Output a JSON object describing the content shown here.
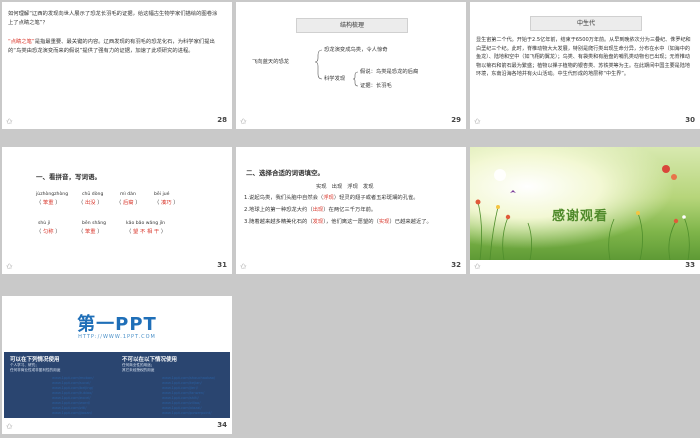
{
  "footer_icon": "slide-star-icon",
  "slides": [
    {
      "number": "28",
      "question": "如何理解“辽西的发现向世人展示了恐龙长羽毛的证据，给这幅古生物学家们描绘的图卷涂上了点睛之笔”？",
      "answer_quote": "“点睛之笔”",
      "answer_rest": "是指最重要、最关键的内容。辽西发现的有羽毛的恐龙化石，为科学家们提出的“鸟类由恐龙演变而来的假说”提供了强有力的证据，加速了此项研究的进程。"
    },
    {
      "number": "29",
      "header": "结构梳理",
      "root": "飞向蓝天的恐龙",
      "branch1": "恐龙演变成鸟类，令人惊奇",
      "branch2": "科学发现",
      "leaf1": "假说：鸟类是恐龙的后裔",
      "leaf2": "证据：长羽毛"
    },
    {
      "number": "30",
      "header": "中生代",
      "body": "显生宙第二个代。开始于2.5亿年前，结束于6500万年前。从早到晚依次分为三叠纪、侏罗纪和白垩纪三个纪。此时，脊椎动物大大发展，特别是爬行类出现生命分异，分布在水中（如海中的鱼龙）、陆地和空中（如飞翔的翼龙）；鸟类、有袋类和有胎盘的哺乳类动物也已出现；无脊椎动物以菊石和箭石最为繁盛；植物以裸子植物的银杏类、苏铁类等为主。在此期间中国主要是陆地环境，东南沿海各地并有火山活动。中生代形成的地层称“中生界”。"
    },
    {
      "number": "31",
      "title": "一、看拼音，写词语。",
      "row1": [
        {
          "pinyin": "jùzhòngzhòng",
          "answer": "笨重"
        },
        {
          "pinyin": "chū dòng",
          "answer": "出没"
        },
        {
          "pinyin": "mì dàn",
          "answer": "后裔"
        },
        {
          "pinyin": "bēi jué",
          "answer": "凑巧"
        }
      ],
      "row2": [
        {
          "pinyin": "shù jì",
          "answer": "匀称"
        },
        {
          "pinyin": "bēn shǎng",
          "answer": "笨重"
        },
        {
          "pinyin": "kǎo bǎo wǎng jǐn",
          "answer": "望 不 相 干"
        }
      ]
    },
    {
      "number": "32",
      "title": "二、选择合适的词语填空。",
      "options": "实现   出现   浮现   发现",
      "s1_a": "1.说起鸟类，我们头脑中自然会（",
      "s1_ans": "浮现",
      "s1_b": "）轻灵的翅子或者五彩斑斓的孔雀。",
      "s2_a": "2.地球上的第一种恐龙大约（",
      "s2_ans": "出现",
      "s2_b": "）在两亿三千万年前。",
      "s3_a": "3.随着越来越多精美化石的（",
      "s3_ans": "发现",
      "s3_b": "），他们离这一愿望的（",
      "s3_ans2": "实现",
      "s3_c": "）已越来越近了。"
    },
    {
      "number": "33",
      "thanks": "感谢观看"
    },
    {
      "number": "34",
      "logo": "第一PPT",
      "url": "HTTP://WWW.1PPT.COM",
      "col1_title": "可以在下列情况使用",
      "col1_lines": [
        "个人学习、研究；",
        "任何非商业性或非盈利性的用途"
      ],
      "col2_title": "不可以在以下情况使用",
      "col2_lines": [
        "任何商业性的用途；",
        "其它未经授权的用途"
      ],
      "links": [
        "www.1ppt.com/moban/",
        "www.1ppt.com/sucai/",
        "www.1ppt.com/beijing/",
        "www.1ppt.com/tubiao/",
        "www.1ppt.com/excel/",
        "www.1ppt.com/word/",
        "www.1ppt.com/ziti/",
        "www.1ppt.com/jiaoan/",
        "www.1ppt.com/shouchaobao/",
        "www.1ppt.com/kejian/",
        "www.1ppt.com/jieri/",
        "www.1ppt.com/fanwen/",
        "www.1ppt.com/shiti/",
        "www.1ppt.com/ziliao/",
        "www.1ppt.com/xiazai/",
        "www.1ppt.com/powerpoint/"
      ]
    }
  ]
}
